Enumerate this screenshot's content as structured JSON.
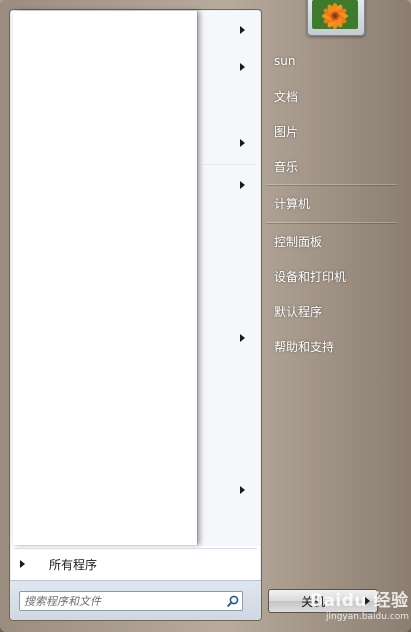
{
  "user": {
    "name": "sun",
    "avatar_icon": "flower-avatar-icon"
  },
  "places": [
    {
      "label": "文档"
    },
    {
      "label": "图片"
    },
    {
      "label": "音乐"
    },
    {
      "label": "计算机"
    },
    {
      "label": "控制面板"
    },
    {
      "label": "设备和打印机"
    },
    {
      "label": "默认程序"
    },
    {
      "label": "帮助和支持"
    }
  ],
  "programs_list": {
    "arrow_icon": "expand-arrow-icon"
  },
  "all_programs": {
    "label": "所有程序"
  },
  "search": {
    "placeholder": "搜索程序和文件",
    "icon": "search-icon"
  },
  "shutdown": {
    "label": "关机",
    "options_icon": "options-arrow-icon"
  },
  "watermark": {
    "brand": "Baidu 经验",
    "url": "jingyan.baidu.com"
  },
  "colors": {
    "accent_orange": "#f07a1a",
    "panel_text": "#ffffff"
  }
}
